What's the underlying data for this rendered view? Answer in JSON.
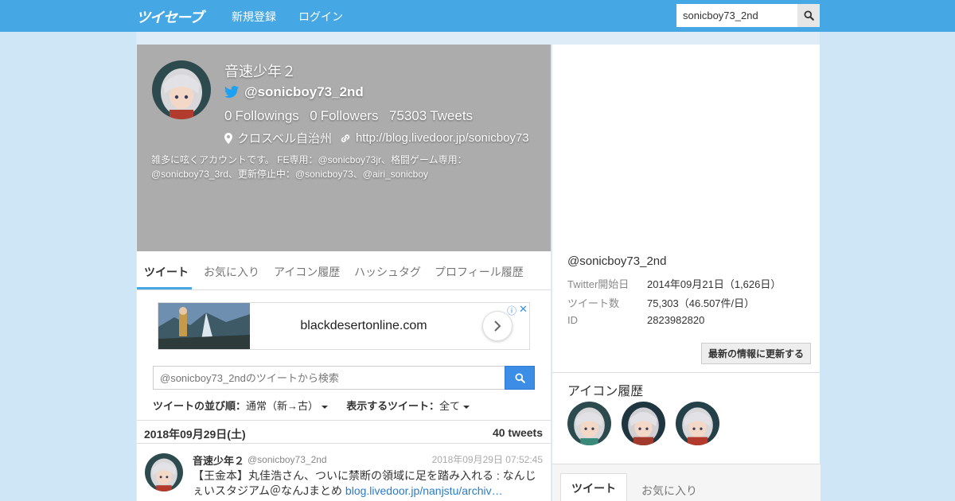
{
  "header": {
    "logo": "ツイセーブ",
    "nav": {
      "signup": "新規登録",
      "login": "ログイン"
    },
    "search_value": "sonicboy73_2nd",
    "search_icon": "search-icon"
  },
  "profile": {
    "name": "音速少年２",
    "handle": "@sonicboy73_2nd",
    "followings_count": "0",
    "followings_label": "Followings",
    "followers_count": "0",
    "followers_label": "Followers",
    "tweets_count": "75303",
    "tweets_label": "Tweets",
    "location": "クロスベル自治州",
    "url": "http://blog.livedoor.jp/sonicboy73",
    "description": "雑多に呟くアカウントです。 FE専用：@sonicboy73jr、格闘ゲーム専用：@sonicboy73_3rd、更新停止中：@sonicboy73、@airi_sonicboy"
  },
  "tabs": [
    "ツイート",
    "お気に入り",
    "アイコン履歴",
    "ハッシュタグ",
    "プロフィール履歴"
  ],
  "ad": {
    "text": "blackdesertonline.com",
    "close": "✕"
  },
  "tweet_search": {
    "placeholder": "@sonicboy73_2ndのツイートから検索"
  },
  "sort": {
    "order_label": "ツイートの並び順：",
    "order_value": "通常（新→古）",
    "filter_label": "表示するツイート：",
    "filter_value": "全て"
  },
  "date_bar": {
    "date": "2018年09月29日(土)",
    "count": "40 tweets"
  },
  "tweet": {
    "name": "音速少年２",
    "handle": "@sonicboy73_2nd",
    "time": "2018年09月29日 07:52:45",
    "text": "【王金本】丸佳浩さん、ついに禁断の領域に足を踏み入れる : なんじぇいスタジアム＠なんJまとめ ",
    "link": "blog.livedoor.jp/nanjstu/archiv…"
  },
  "sidebar": {
    "handle": "@sonicboy73_2nd",
    "rows": [
      {
        "key": "Twitter開始日",
        "value": "2014年09月21日（1,626日）"
      },
      {
        "key": "ツイート数",
        "value": "75,303（46.507件/日）"
      },
      {
        "key": "ID",
        "value": "2823982820"
      }
    ],
    "update_button": "最新の情報に更新する",
    "icon_history_title": "アイコン履歴",
    "tabs": [
      "ツイート",
      "お気に入り"
    ]
  }
}
